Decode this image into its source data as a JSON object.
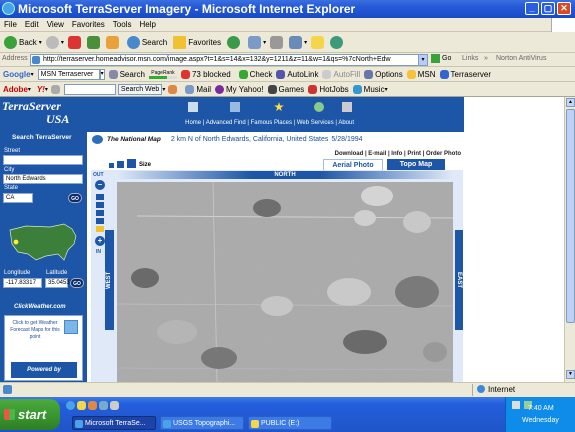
{
  "window": {
    "title": "Microsoft TerraServer Imagery - Microsoft Internet Explorer"
  },
  "menu": [
    "File",
    "Edit",
    "View",
    "Favorites",
    "Tools",
    "Help"
  ],
  "toolbar": {
    "back": "Back",
    "search": "Search",
    "favorites": "Favorites"
  },
  "address": {
    "label": "Address",
    "url": "http://terraserver.homeadvisor.msn.com/image.aspx?t=1&s=14&x=132&y=1211&z=11&w=1&qs=%7cNorth+Edw",
    "go": "Go",
    "links": "Links",
    "norton": "Norton AntiVirus"
  },
  "google_bar": {
    "label": "Google",
    "input_value": "MSN Terraserver",
    "search": "Search",
    "pagerank": "PageRank",
    "blocked": "73 blocked",
    "check": "Check",
    "autolink": "AutoLink",
    "autofill": "AutoFill",
    "options": "Options",
    "msn": "MSN",
    "terraserver": "Terraserver"
  },
  "yahoo_bar": {
    "adobe": "Adobe",
    "search_web": "Search Web",
    "mail": "Mail",
    "my_yahoo": "My Yahoo!",
    "games": "Games",
    "hotjobs": "HotJobs",
    "music": "Music"
  },
  "site": {
    "logo_line1": "TerraServer",
    "logo_line2": "USA",
    "nav": "Home | Advanced Find | Famous Places | Web Services | About",
    "search_title": "Search TerraServer",
    "street_label": "Street",
    "street_value": "",
    "city_label": "City",
    "city_value": "North Edwards",
    "state_label": "State",
    "state_value": "CA",
    "go": "GO",
    "longitude_label": "Longitude",
    "latitude_label": "Latitude",
    "longitude_value": "-117.83317",
    "latitude_value": "35.04532",
    "cw_title": "ClickWeather.com",
    "cw_text": "Click to get Weather Forecast Maps for this point",
    "cw_powered": "Powered by",
    "national_map": "The National Map",
    "location": "2 km N of North Edwards, California, United States",
    "date": "5/28/1994",
    "actions": "Download | E-mail | Info | Print | Order Photo",
    "size_label": "Size",
    "tab_aerial": "Aerial Photo",
    "tab_topo": "Topo Map",
    "out": "OUT",
    "in": "IN",
    "north": "NORTH",
    "west": "WEST",
    "east": "EAST"
  },
  "status": {
    "zone": "Internet"
  },
  "taskbar": {
    "start": "start",
    "tasks": [
      "Microsoft TerraSe...",
      "USGS Topographi...",
      "PUBLIC (E:)"
    ],
    "clock": "7:40 AM",
    "day": "Wednesday"
  }
}
